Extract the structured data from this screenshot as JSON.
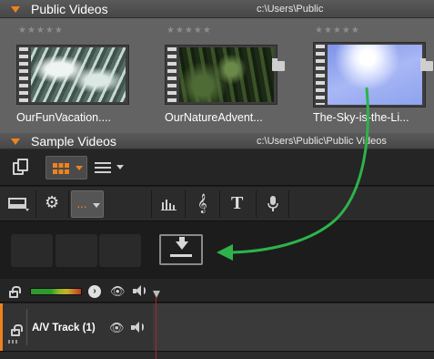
{
  "public_videos": {
    "title": "Public Videos",
    "path": "c:\\Users\\Public",
    "clips": [
      {
        "name": "OurFunVacation....",
        "stars": "★★★★★",
        "thumb": "water"
      },
      {
        "name": "OurNatureAdvent...",
        "stars": "★★★★★",
        "thumb": "forest"
      },
      {
        "name": "The-Sky-is-the-Li...",
        "stars": "★★★★★",
        "thumb": "sky"
      }
    ]
  },
  "sample_videos": {
    "title": "Sample Videos",
    "path": "c:\\Users\\Public\\Public Videos"
  },
  "track": {
    "name": "A/V Track (1)"
  },
  "colors": {
    "accent": "#f0821e",
    "arrow": "#2db34a",
    "playhead": "#b0232a"
  },
  "icons": [
    "stack-icon",
    "grid-view-icon",
    "list-view-icon",
    "storyboard-icon",
    "gear-icon",
    "dots-icon",
    "audio-levels-icon",
    "treble-clef-icon",
    "title-text-icon",
    "microphone-icon",
    "download-drop-icon",
    "lock-icon",
    "eye-icon",
    "speaker-icon"
  ]
}
